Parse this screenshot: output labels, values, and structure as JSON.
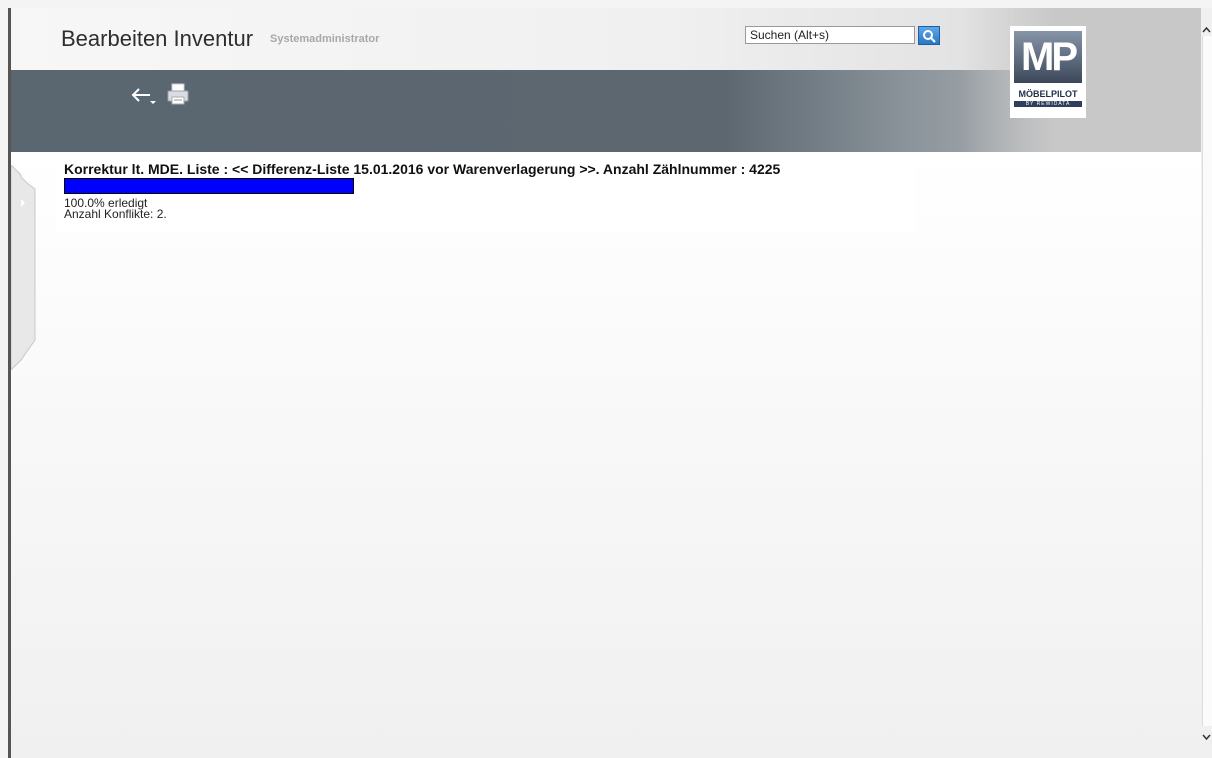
{
  "header": {
    "title": "Bearbeiten Inventur",
    "user": "Systemadministrator",
    "search_placeholder": "Suchen (Alt+s)"
  },
  "logo": {
    "mark": "MP",
    "name": "MÖBELPILOT",
    "sub": "BY REWIDATA"
  },
  "toolbar": {
    "back_icon": "back-arrow-icon",
    "print_icon": "printer-icon"
  },
  "panel": {
    "title": "Korrektur lt. MDE. Liste : << Differenz-Liste 15.01.2016 vor Warenverlagerung >>. Anzahl Zählnummer : 4225",
    "progress_percent": 100,
    "progress_label": "100.0% erledigt",
    "conflicts_label": "Anzahl Konflikte: 2."
  },
  "colors": {
    "progress_fill": "#0000ff",
    "toolbar": "#5c6770",
    "search_button": "#2a78c4"
  }
}
